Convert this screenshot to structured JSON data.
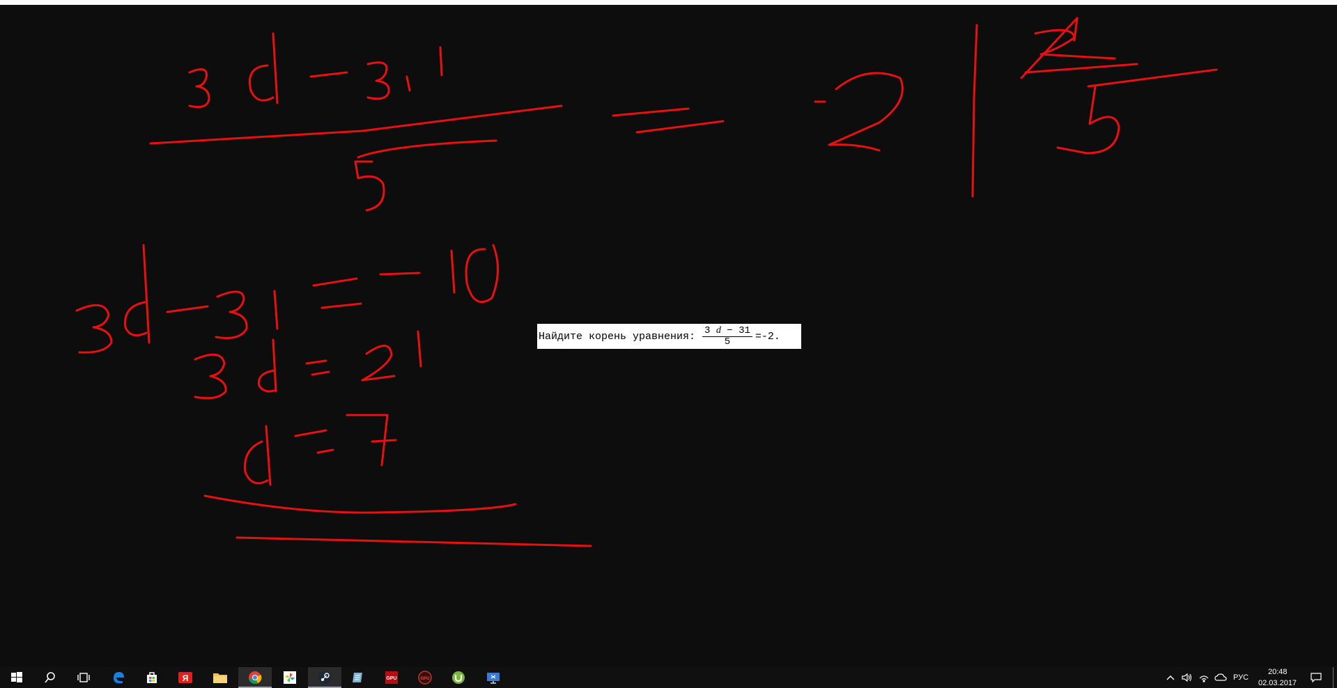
{
  "problem": {
    "label": "Найдите корень уравнения:",
    "numerator_coef": "3",
    "numerator_var": "d",
    "numerator_rest": "− 31",
    "denominator": "5",
    "rhs": "=-2."
  },
  "ink_color": "#e81010",
  "taskbar": {
    "icons": [
      "windows-start-icon",
      "search-icon",
      "task-view-icon",
      "edge-icon",
      "store-icon",
      "yandex-icon",
      "file-explorer-icon",
      "chrome-icon",
      "pinwheel-app-icon",
      "steam-icon",
      "notepad-icon",
      "gpu-z-icon",
      "gpu-tweak-icon",
      "utorrent-icon",
      "remote-desktop-icon"
    ],
    "tray": {
      "language": "РУС",
      "time": "20:48",
      "date": "02.03.2017"
    }
  }
}
